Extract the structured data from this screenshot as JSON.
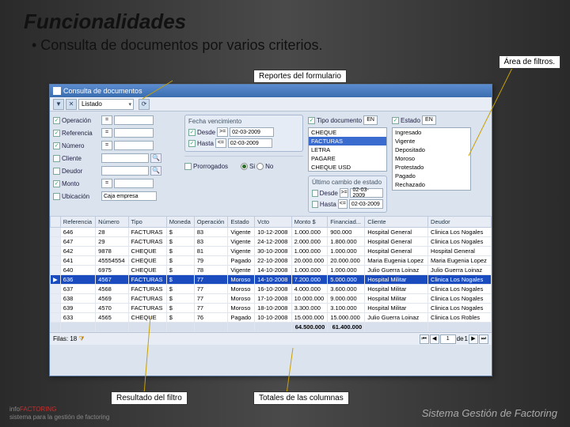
{
  "slide": {
    "title": "Funcionalidades",
    "bullet": "• Consulta de documentos por varios criterios."
  },
  "callouts": {
    "area": "Área de filtros.",
    "reportes": "Reportes del formulario",
    "resultado": "Resultado del filtro",
    "totales": "Totales de las columnas"
  },
  "window": {
    "title": "Consulta de documentos"
  },
  "toolbar": {
    "combo": "Listado"
  },
  "filters": {
    "left": [
      {
        "chk": true,
        "label": "Operación",
        "op": "="
      },
      {
        "chk": true,
        "label": "Referencia",
        "op": "="
      },
      {
        "chk": true,
        "label": "Número",
        "op": "="
      },
      {
        "chk": false,
        "label": "Cliente"
      },
      {
        "chk": false,
        "label": "Deudor"
      },
      {
        "chk": true,
        "label": "Monto",
        "op": "="
      },
      {
        "chk": false,
        "label": "Ubicación",
        "val": "Caja empresa"
      }
    ],
    "fecha_venc": {
      "title": "Fecha vencimiento",
      "desde": {
        "chk": true,
        "label": "Desde",
        "op": ">=",
        "val": "02-03-2009"
      },
      "hasta": {
        "chk": true,
        "label": "Hasta",
        "op": "<=",
        "val": "02-03-2009"
      }
    },
    "prorrogados": {
      "label": "Prorrogados",
      "si": "Si",
      "no": "No"
    },
    "tipo_doc": {
      "chk": true,
      "label": "Tipo documento",
      "cmp": "EN",
      "options": [
        "CHEQUE",
        "FACTURAS",
        "LETRA",
        "PAGARE",
        "CHEQUE USD"
      ],
      "sel": 1
    },
    "estado": {
      "chk": true,
      "label": "Estado",
      "cmp": "EN",
      "options": [
        "Ingresado",
        "Vigente",
        "Depositado",
        "Moroso",
        "Protestado",
        "Pagado",
        "Rechazado"
      ]
    },
    "ultimo_cambio": {
      "title": "Último cambio de estado",
      "desde": {
        "chk": false,
        "label": "Desde",
        "op": ">=",
        "val": "02-03-2009"
      },
      "hasta": {
        "chk": false,
        "label": "Hasta",
        "op": "<=",
        "val": "02-03-2009"
      }
    }
  },
  "grid": {
    "columns": [
      "Referencia",
      "Número",
      "Tipo",
      "Moneda",
      "Operación",
      "Estado",
      "Vcto",
      "Monto $",
      "Financiad...",
      "Cliente",
      "Deudor"
    ],
    "rows": [
      [
        "646",
        "28",
        "FACTURAS",
        "$",
        "83",
        "Vigente",
        "10-12-2008",
        "1.000.000",
        "900.000",
        "Hospital General",
        "Clinica Los Nogales"
      ],
      [
        "647",
        "29",
        "FACTURAS",
        "$",
        "83",
        "Vigente",
        "24-12-2008",
        "2.000.000",
        "1.800.000",
        "Hospital General",
        "Clinica Los Nogales"
      ],
      [
        "642",
        "9878",
        "CHEQUE",
        "$",
        "81",
        "Vigente",
        "30-10-2008",
        "1.000.000",
        "1.000.000",
        "Hospital General",
        "Hospital General"
      ],
      [
        "641",
        "45554554",
        "CHEQUE",
        "$",
        "79",
        "Pagado",
        "22-10-2008",
        "20.000.000",
        "20.000.000",
        "Maria Eugenia Lopez",
        "Maria Eugenia Lopez"
      ],
      [
        "640",
        "6975",
        "CHEQUE",
        "$",
        "78",
        "Vigente",
        "14-10-2008",
        "1.000.000",
        "1.000.000",
        "Julio Guerra Loinaz",
        "Julio Guerra Loinaz"
      ],
      [
        "636",
        "4567",
        "FACTURAS",
        "$",
        "77",
        "Moroso",
        "14-10-2008",
        "7.200.000",
        "5.000.000",
        "Hospital Militar",
        "Clinica Los Nogales"
      ],
      [
        "637",
        "4568",
        "FACTURAS",
        "$",
        "77",
        "Moroso",
        "16-10-2008",
        "4.000.000",
        "3.600.000",
        "Hospital Militar",
        "Clinica Los Nogales"
      ],
      [
        "638",
        "4569",
        "FACTURAS",
        "$",
        "77",
        "Moroso",
        "17-10-2008",
        "10.000.000",
        "9.000.000",
        "Hospital Militar",
        "Clinica Los Nogales"
      ],
      [
        "639",
        "4570",
        "FACTURAS",
        "$",
        "77",
        "Moroso",
        "18-10-2008",
        "3.300.000",
        "3.100.000",
        "Hospital Militar",
        "Clinica Los Nogales"
      ],
      [
        "633",
        "4565",
        "CHEQUE",
        "$",
        "76",
        "Pagado",
        "10-10-2008",
        "15.000.000",
        "15.000.000",
        "Julio Guerra Loinaz",
        "Clinica Los Robles"
      ]
    ],
    "sel": 5,
    "totals": [
      "",
      "",
      "",
      "",
      "",
      "",
      "",
      "64.500.000",
      "61.400.000",
      "",
      ""
    ]
  },
  "status": {
    "filas_label": "Filas:",
    "filas": "18",
    "page": "1",
    "de": "de",
    "pages": "1"
  },
  "footer": {
    "logo1": "info",
    "logo2": "FACTORING",
    "sub": "sistema para la gestión de factoring",
    "right": "Sistema Gestión de Factoring"
  }
}
